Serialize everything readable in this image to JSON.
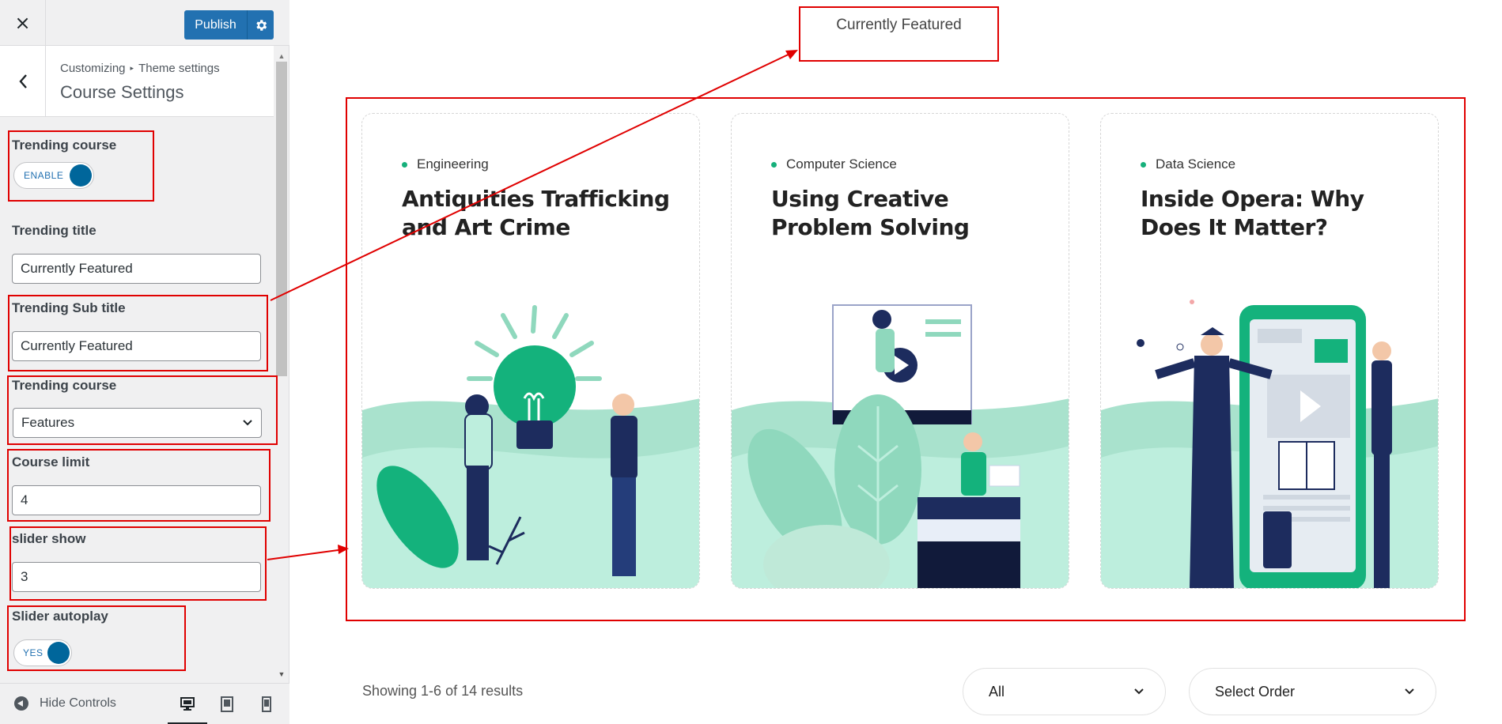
{
  "topbar": {
    "close_glyph": "×",
    "publish_label": "Publish"
  },
  "section": {
    "breadcrumb_root": "Customizing",
    "breadcrumb_sep": "▸",
    "breadcrumb_current": "Theme settings",
    "title": "Course Settings"
  },
  "controls": {
    "trending_course_label": "Trending course",
    "trending_course_toggle": "ENABLE",
    "trending_title_label": "Trending title",
    "trending_title_value": "Currently Featured",
    "trending_subtitle_label": "Trending Sub title",
    "trending_subtitle_value": "Currently Featured",
    "trending_course_select_label": "Trending course",
    "trending_course_select_value": "Features",
    "course_limit_label": "Course limit",
    "course_limit_value": "4",
    "slider_show_label": "slider show",
    "slider_show_value": "3",
    "slider_autoplay_label": "Slider autoplay",
    "slider_autoplay_toggle": "YES"
  },
  "footer": {
    "hide_controls_label": "Hide Controls"
  },
  "preview": {
    "trending_subtitle": "Currently Featured",
    "cards": [
      {
        "category": "Engineering",
        "title": "Antiquities Trafficking and Art Crime"
      },
      {
        "category": "Computer Science",
        "title": "Using Creative Problem Solving"
      },
      {
        "category": "Data Science",
        "title": "Inside Opera: Why Does It Matter?"
      }
    ],
    "results_text": "Showing 1-6 of 14 results",
    "filter_value": "All",
    "order_value": "Select Order"
  },
  "colors": {
    "accent": "#2271b1",
    "annotation_red": "#e00000",
    "brand_green": "#16b07b",
    "illustration_mint": "#bdeedd"
  },
  "icons": [
    "close-icon",
    "gear-icon",
    "back-arrow-icon",
    "chevron-down-icon",
    "hide-controls-icon",
    "desktop-icon",
    "tablet-icon",
    "mobile-icon"
  ]
}
